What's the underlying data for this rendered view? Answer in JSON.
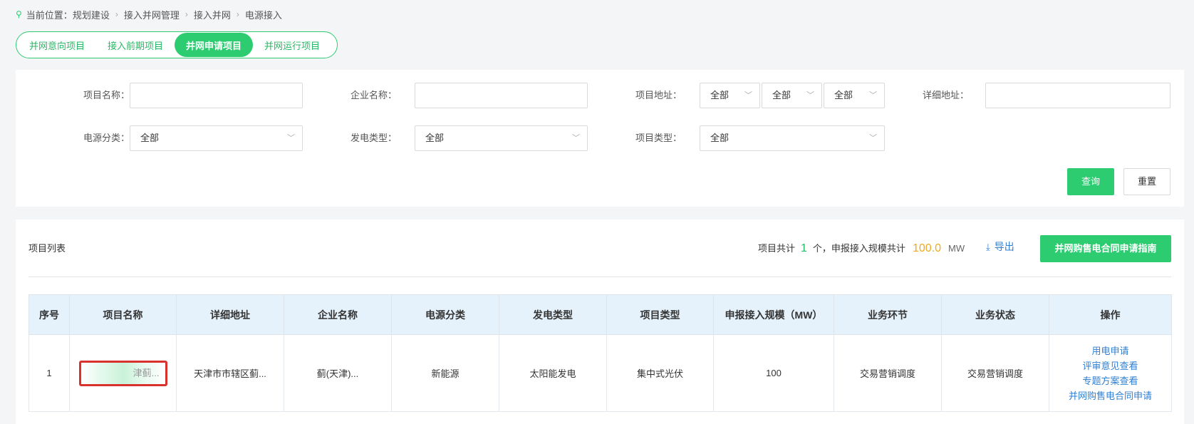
{
  "breadcrumb": {
    "prefix": "当前位置：",
    "items": [
      "规划建设",
      "接入并网管理",
      "接入并网",
      "电源接入"
    ]
  },
  "tabs": [
    {
      "label": "并网意向项目",
      "active": false
    },
    {
      "label": "接入前期项目",
      "active": false
    },
    {
      "label": "并网申请项目",
      "active": true
    },
    {
      "label": "并网运行项目",
      "active": false
    }
  ],
  "filters": {
    "project_name_label": "项目名称：",
    "project_name_value": "",
    "company_name_label": "企业名称：",
    "company_name_value": "",
    "address_label": "项目地址：",
    "address_selects": [
      "全部",
      "全部",
      "全部"
    ],
    "detail_address_label": "详细地址：",
    "detail_address_value": "",
    "power_category_label": "电源分类：",
    "power_category_value": "全部",
    "generation_type_label": "发电类型：",
    "generation_type_value": "全部",
    "project_type_label": "项目类型：",
    "project_type_value": "全部",
    "query_label": "查询",
    "reset_label": "重置"
  },
  "list": {
    "title": "项目列表",
    "summary_prefix": "项目共计",
    "count": "1",
    "summary_mid": "个，申报接入规模共计",
    "scale": "100.0",
    "unit": "MW",
    "export_label": "导出",
    "guide_button": "并网购售电合同申请指南",
    "columns": [
      "序号",
      "项目名称",
      "详细地址",
      "企业名称",
      "电源分类",
      "发电类型",
      "项目类型",
      "申报接入规模（MW）",
      "业务环节",
      "业务状态",
      "操作"
    ],
    "rows": [
      {
        "index": "1",
        "name": "津蓟...",
        "address": "天津市市辖区蓟...",
        "company": "蓟(天津)...",
        "power_category": "新能源",
        "generation_type": "太阳能发电",
        "project_type": "集中式光伏",
        "scale": "100",
        "stage": "交易营销调度",
        "status": "交易营销调度",
        "actions": [
          "用电申请",
          "评审意见查看",
          "专题方案查看",
          "并网购售电合同申请"
        ]
      }
    ]
  },
  "colors": {
    "accent": "#2ecc71",
    "link": "#2f7fd0",
    "highlight": "#f0a81c",
    "annotation_box": "#d9312b"
  }
}
